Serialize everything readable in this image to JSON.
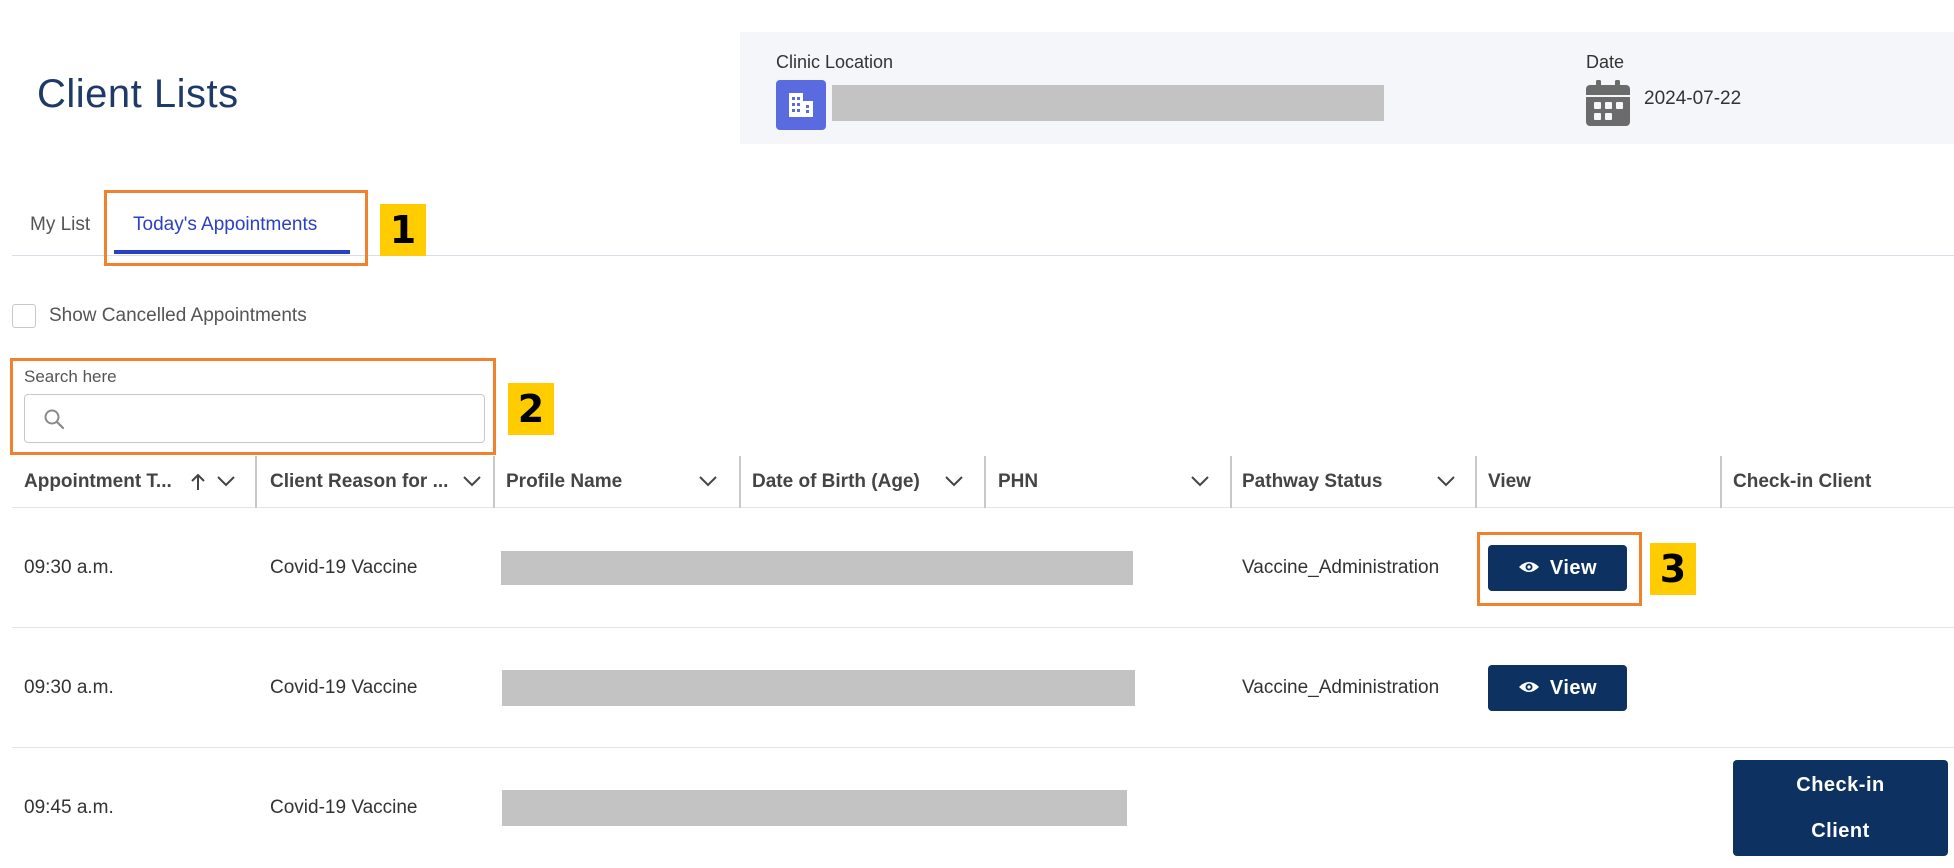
{
  "page": {
    "title": "Client Lists"
  },
  "clinic": {
    "label": "Clinic Location",
    "icon": "building-icon"
  },
  "date": {
    "label": "Date",
    "value": "2024-07-22",
    "icon": "calendar-icon"
  },
  "tabs": [
    {
      "label": "My List",
      "active": false
    },
    {
      "label": "Today's Appointments",
      "active": true
    }
  ],
  "filters": {
    "show_cancelled_label": "Show Cancelled Appointments",
    "show_cancelled_checked": false
  },
  "search": {
    "label": "Search here",
    "placeholder": "",
    "value": ""
  },
  "callouts": [
    "1",
    "2",
    "3"
  ],
  "colors": {
    "accent": "#2a41c4",
    "primary_button": "#0d3261",
    "callout_border": "#f0822d",
    "callout_badge": "#ffcc00",
    "clinic_icon": "#5a6be0"
  },
  "table": {
    "columns": [
      "Appointment T...",
      "Client Reason for ...",
      "Profile Name",
      "Date of Birth (Age)",
      "PHN",
      "Pathway Status",
      "View",
      "Check-in Client"
    ],
    "rows": [
      {
        "time": "09:30 a.m.",
        "reason": "Covid-19 Vaccine",
        "pathway": "Vaccine_Administration",
        "view_label": "View"
      },
      {
        "time": "09:30 a.m.",
        "reason": "Covid-19 Vaccine",
        "pathway": "Vaccine_Administration",
        "view_label": "View"
      },
      {
        "time": "09:45 a.m.",
        "reason": "Covid-19 Vaccine",
        "pathway": "",
        "checkin_label_line1": "Check-in",
        "checkin_label_line2": "Client"
      }
    ]
  }
}
